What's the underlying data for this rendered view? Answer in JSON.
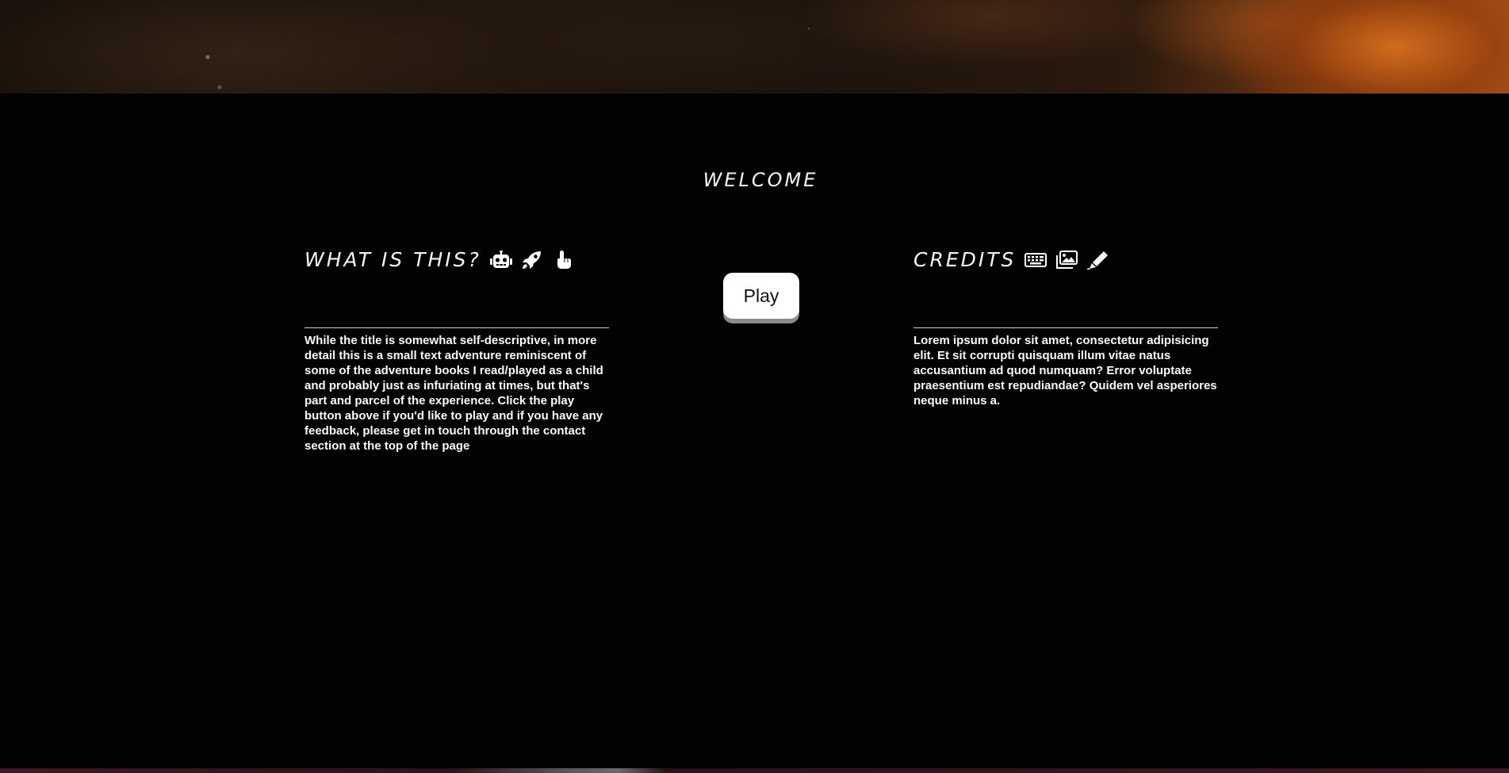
{
  "welcome": {
    "title": "WELCOME"
  },
  "about": {
    "heading": "WHAT IS THIS?",
    "icons": [
      "robot-icon",
      "rocket-icon",
      "pointing-hand-icon"
    ],
    "body": "While the title is somewhat self-descriptive, in more detail this is a small text adventure reminiscent of some of the adventure books I read/played as a child and probably just as infuriating at times, but that's part and parcel of the experience. Click the play button above if you'd like to play and if you have any feedback, please get in touch through the contact section at the top of the page"
  },
  "play": {
    "label": "Play"
  },
  "credits": {
    "heading": "CREDITS",
    "icons": [
      "keyboard-icon",
      "images-icon",
      "pen-icon"
    ],
    "body": "Lorem ipsum dolor sit amet, consectetur adipisicing elit. Et sit corrupti quisquam illum vitae natus accusantium ad quod numquam? Error voluptate praesentium est repudiandae? Quidem vel asperiores neque minus a."
  },
  "colors": {
    "background": "#020202",
    "text": "#f4f4f4",
    "button": "#ffffff",
    "button_shadow": "#8b8b8b",
    "banner_accent": "#a55219"
  }
}
